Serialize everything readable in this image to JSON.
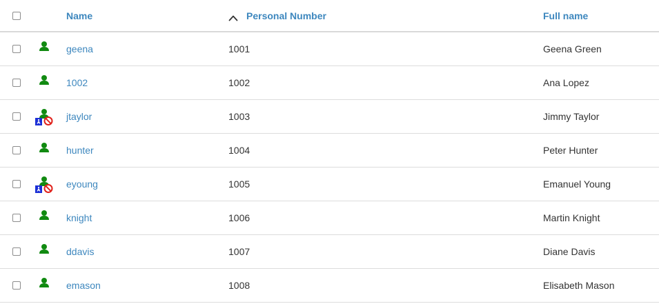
{
  "header": {
    "name": "Name",
    "personal_number": "Personal Number",
    "full_name": "Full name",
    "sort_icon": "chevron-up-icon"
  },
  "rows": [
    {
      "name": "geena",
      "number": "1001",
      "full_name": "Geena Green",
      "icon": "user-icon"
    },
    {
      "name": "1002",
      "number": "1002",
      "full_name": "Ana Lopez",
      "icon": "user-icon"
    },
    {
      "name": "jtaylor",
      "number": "1003",
      "full_name": "Jimmy Taylor",
      "icon": "user-disabled-icon"
    },
    {
      "name": "hunter",
      "number": "1004",
      "full_name": "Peter Hunter",
      "icon": "user-icon"
    },
    {
      "name": "eyoung",
      "number": "1005",
      "full_name": "Emanuel Young",
      "icon": "user-disabled-icon"
    },
    {
      "name": "knight",
      "number": "1006",
      "full_name": "Martin Knight",
      "icon": "user-icon"
    },
    {
      "name": "ddavis",
      "number": "1007",
      "full_name": "Diane Davis",
      "icon": "user-icon"
    },
    {
      "name": "emason",
      "number": "1008",
      "full_name": "Elisabeth Mason",
      "icon": "user-icon"
    }
  ],
  "colors": {
    "link": "#3d87be",
    "user_green": "#118a11",
    "disabled_red": "#e0211b",
    "badge_blue": "#1b2fd6"
  }
}
